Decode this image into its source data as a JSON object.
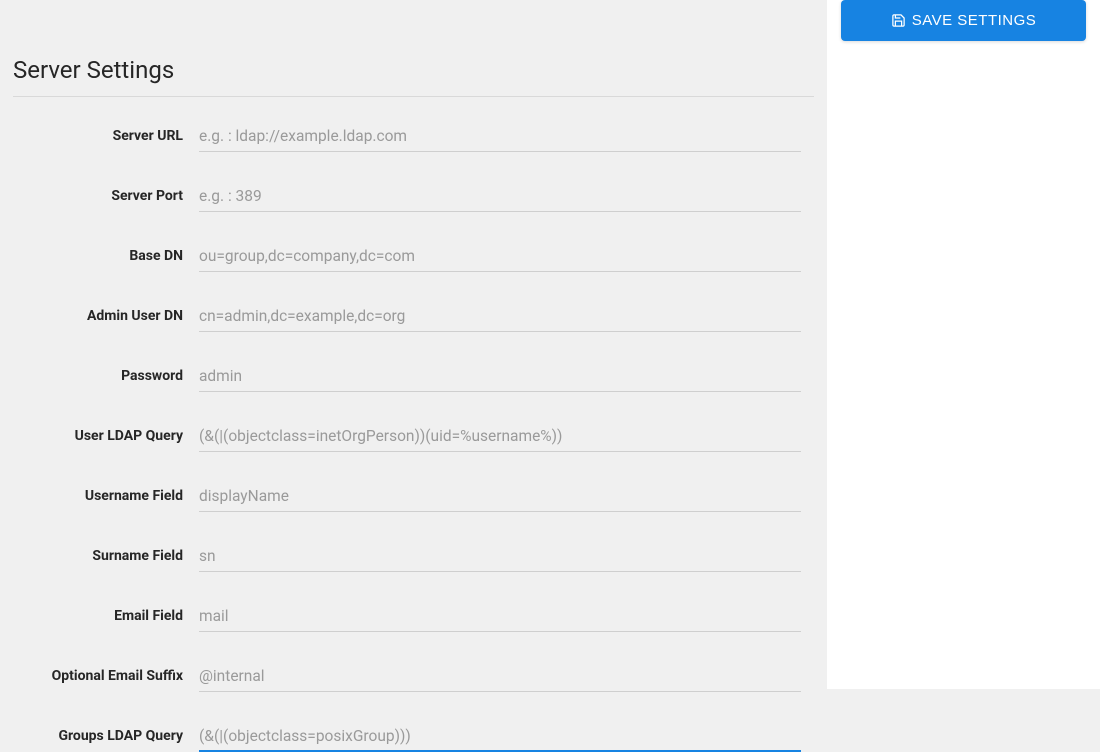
{
  "actions": {
    "save_label": "SAVE SETTINGS"
  },
  "section": {
    "title": "Server Settings"
  },
  "fields": {
    "server_url": {
      "label": "Server URL",
      "placeholder": "e.g. : ldap://example.ldap.com",
      "value": ""
    },
    "server_port": {
      "label": "Server Port",
      "placeholder": "e.g. : 389",
      "value": ""
    },
    "base_dn": {
      "label": "Base DN",
      "placeholder": "ou=group,dc=company,dc=com",
      "value": ""
    },
    "admin_user_dn": {
      "label": "Admin User DN",
      "placeholder": "cn=admin,dc=example,dc=org",
      "value": ""
    },
    "password": {
      "label": "Password",
      "placeholder": "admin",
      "value": ""
    },
    "user_ldap_query": {
      "label": "User LDAP Query",
      "placeholder": "(&(|(objectclass=inetOrgPerson))(uid=%username%))",
      "value": ""
    },
    "username_field": {
      "label": "Username Field",
      "placeholder": "displayName",
      "value": ""
    },
    "surname_field": {
      "label": "Surname Field",
      "placeholder": "sn",
      "value": ""
    },
    "email_field": {
      "label": "Email Field",
      "placeholder": "mail",
      "value": ""
    },
    "optional_email_suffix": {
      "label": "Optional Email Suffix",
      "placeholder": "@internal",
      "value": ""
    },
    "groups_ldap_query": {
      "label": "Groups LDAP Query",
      "placeholder": "(&(|(objectclass=posixGroup)))",
      "value": ""
    }
  }
}
